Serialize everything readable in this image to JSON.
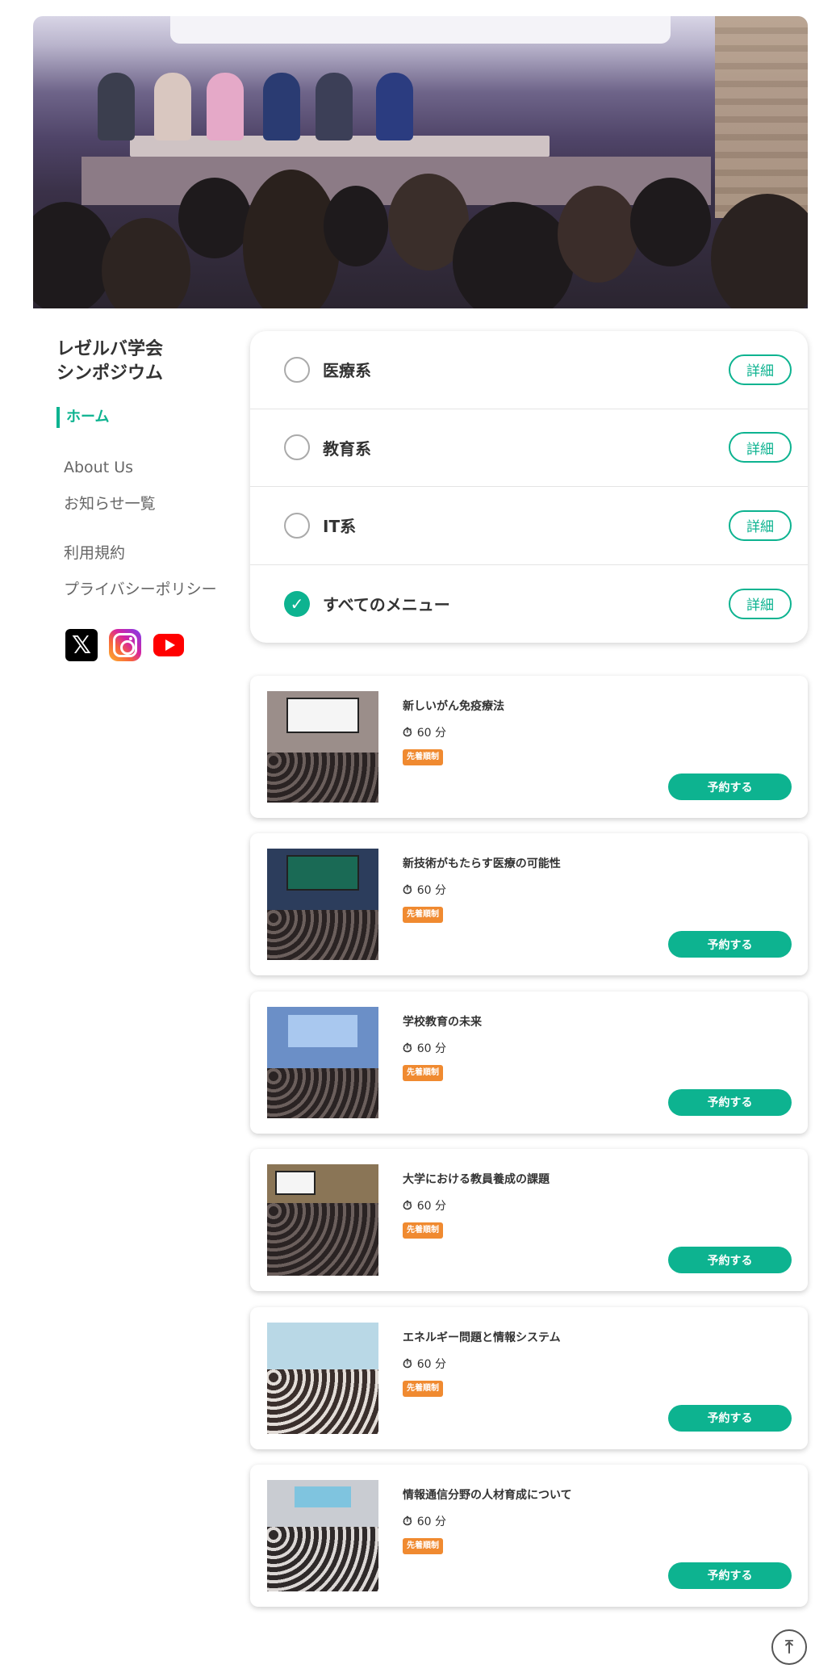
{
  "sidebar": {
    "site_title": "レゼルバ学会\nシンポジウム",
    "nav": {
      "home": "ホーム",
      "about": "About Us",
      "news": "お知らせ一覧",
      "terms": "利用規約",
      "privacy": "プライバシーポリシー"
    },
    "social": [
      "x-icon",
      "instagram-icon",
      "youtube-icon"
    ]
  },
  "categories": [
    {
      "label": "医療系",
      "checked": false,
      "detail": "詳細"
    },
    {
      "label": "教育系",
      "checked": false,
      "detail": "詳細"
    },
    {
      "label": "IT系",
      "checked": false,
      "detail": "詳細"
    },
    {
      "label": "すべてのメニュー",
      "checked": true,
      "detail": "詳細"
    }
  ],
  "sessions": [
    {
      "title": "新しいがん免疫療法",
      "duration": "60 分",
      "badge": "先着順制",
      "button": "予約する"
    },
    {
      "title": "新技術がもたらす医療の可能性",
      "duration": "60 分",
      "badge": "先着順制",
      "button": "予約する"
    },
    {
      "title": "学校教育の未来",
      "duration": "60 分",
      "badge": "先着順制",
      "button": "予約する"
    },
    {
      "title": "大学における教員養成の課題",
      "duration": "60 分",
      "badge": "先着順制",
      "button": "予約する"
    },
    {
      "title": "エネルギー問題と情報システム",
      "duration": "60 分",
      "badge": "先着順制",
      "button": "予約する"
    },
    {
      "title": "情報通信分野の人材育成について",
      "duration": "60 分",
      "badge": "先着順制",
      "button": "予約する"
    }
  ],
  "colors": {
    "accent": "#0db390",
    "badge": "#f08a30"
  },
  "icons": {
    "timer": "stopwatch-icon",
    "check": "check-icon",
    "back_to_top": "arrow-up-icon"
  }
}
